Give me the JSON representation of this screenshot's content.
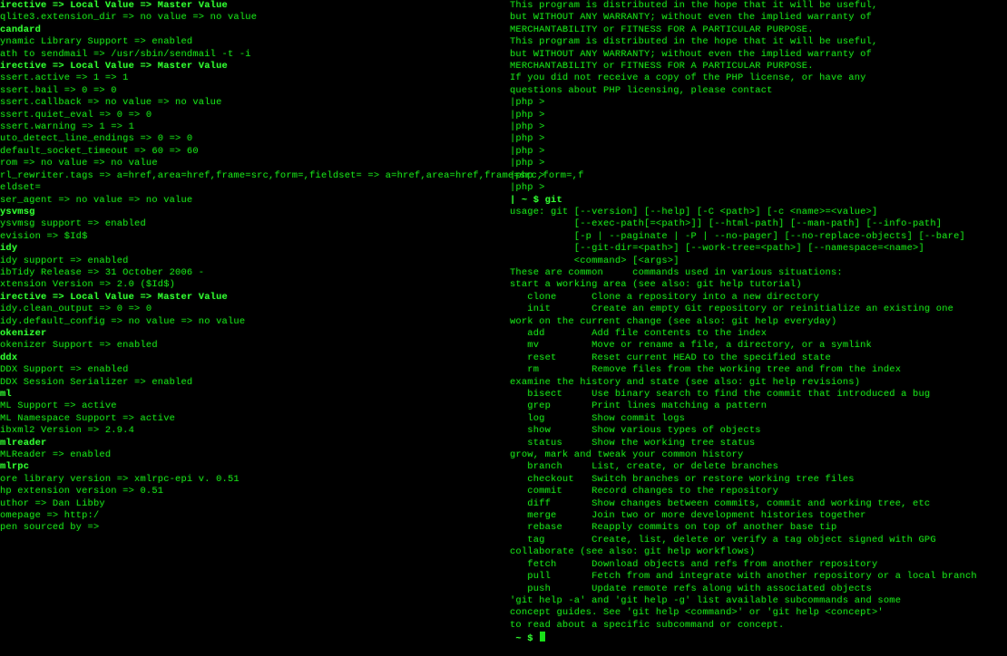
{
  "colors": {
    "background": "#000000",
    "text": "#19e019",
    "bright": "#34ff34"
  },
  "left_column": [
    {
      "t": "irective => Local Value => Master Value",
      "c": "bright"
    },
    {
      "t": "qlite3.extension_dir => no value => no value"
    },
    {
      "t": ""
    },
    {
      "t": "candard",
      "c": "bright"
    },
    {
      "t": ""
    },
    {
      "t": "ynamic Library Support => enabled"
    },
    {
      "t": "ath to sendmail => /usr/sbin/sendmail -t -i"
    },
    {
      "t": ""
    },
    {
      "t": "irective => Local Value => Master Value",
      "c": "bright"
    },
    {
      "t": "ssert.active => 1 => 1"
    },
    {
      "t": "ssert.bail => 0 => 0"
    },
    {
      "t": "ssert.callback => no value => no value"
    },
    {
      "t": "ssert.quiet_eval => 0 => 0"
    },
    {
      "t": "ssert.warning => 1 => 1"
    },
    {
      "t": "uto_detect_line_endings => 0 => 0"
    },
    {
      "t": "default_socket_timeout => 60 => 60"
    },
    {
      "t": "rom => no value => no value"
    },
    {
      "t": "rl_rewriter.tags => a=href,area=href,frame=src,form=,fieldset= => a=href,area=href,frame=src,form=,f"
    },
    {
      "t": "eldset="
    },
    {
      "t": "ser_agent => no value => no value"
    },
    {
      "t": ""
    },
    {
      "t": "ysvmsg",
      "c": "bright"
    },
    {
      "t": ""
    },
    {
      "t": "ysvmsg support => enabled"
    },
    {
      "t": "evision => $Id$"
    },
    {
      "t": ""
    },
    {
      "t": "idy",
      "c": "bright"
    },
    {
      "t": ""
    },
    {
      "t": "idy support => enabled"
    },
    {
      "t": "ibTidy Release => 31 October 2006 -"
    },
    {
      "t": "xtension Version => 2.0 ($Id$)"
    },
    {
      "t": ""
    },
    {
      "t": "irective => Local Value => Master Value",
      "c": "bright"
    },
    {
      "t": "idy.clean_output => 0 => 0"
    },
    {
      "t": "idy.default_config => no value => no value"
    },
    {
      "t": ""
    },
    {
      "t": "okenizer",
      "c": "bright"
    },
    {
      "t": ""
    },
    {
      "t": "okenizer Support => enabled"
    },
    {
      "t": ""
    },
    {
      "t": "ddx",
      "c": "bright"
    },
    {
      "t": ""
    },
    {
      "t": "DDX Support => enabled"
    },
    {
      "t": "DDX Session Serializer => enabled"
    },
    {
      "t": ""
    },
    {
      "t": "ml",
      "c": "bright"
    },
    {
      "t": ""
    },
    {
      "t": "ML Support => active"
    },
    {
      "t": "ML Namespace Support => active"
    },
    {
      "t": "ibxml2 Version => 2.9.4"
    },
    {
      "t": ""
    },
    {
      "t": "mlreader",
      "c": "bright"
    },
    {
      "t": ""
    },
    {
      "t": "MLReader => enabled"
    },
    {
      "t": ""
    },
    {
      "t": "mlrpc",
      "c": "bright"
    },
    {
      "t": ""
    },
    {
      "t": "ore library version => xmlrpc-epi v. 0.51"
    },
    {
      "t": "hp extension version => 0.51"
    },
    {
      "t": "uthor => Dan Libby"
    },
    {
      "t": "omepage => http:/"
    },
    {
      "t": "pen sourced by =>"
    }
  ],
  "right_column": [
    {
      "t": "This program is distributed in the hope that it will be useful,"
    },
    {
      "t": "but WITHOUT ANY WARRANTY; without even the implied warranty of"
    },
    {
      "t": "MERCHANTABILITY or FITNESS FOR A PARTICULAR PURPOSE."
    },
    {
      "t": ""
    },
    {
      "t": "This program is distributed in the hope that it will be useful,"
    },
    {
      "t": "but WITHOUT ANY WARRANTY; without even the implied warranty of"
    },
    {
      "t": "MERCHANTABILITY or FITNESS FOR A PARTICULAR PURPOSE."
    },
    {
      "t": ""
    },
    {
      "t": "If you did not receive a copy of the PHP license, or have any"
    },
    {
      "t": "questions about PHP licensing, please contact"
    },
    {
      "t": "|php >"
    },
    {
      "t": "|php >"
    },
    {
      "t": "|php >"
    },
    {
      "t": "|php >"
    },
    {
      "t": "|php >"
    },
    {
      "t": "|php >"
    },
    {
      "t": "|php >"
    },
    {
      "t": "|php >"
    },
    {
      "t": "| ~ $ git",
      "c": "bright"
    },
    {
      "t": "usage: git [--version] [--help] [-C <path>] [-c <name>=<value>]"
    },
    {
      "t": "           [--exec-path[=<path>]] [--html-path] [--man-path] [--info-path]"
    },
    {
      "t": "           [-p | --paginate | -P | --no-pager] [--no-replace-objects] [--bare]"
    },
    {
      "t": "           [--git-dir=<path>] [--work-tree=<path>] [--namespace=<name>]"
    },
    {
      "t": "           <command> [<args>]"
    },
    {
      "t": ""
    },
    {
      "t": "These are common     commands used in various situations:"
    },
    {
      "t": ""
    },
    {
      "t": "start a working area (see also: git help tutorial)"
    },
    {
      "t": "   clone      Clone a repository into a new directory"
    },
    {
      "t": "   init       Create an empty Git repository or reinitialize an existing one"
    },
    {
      "t": ""
    },
    {
      "t": "work on the current change (see also: git help everyday)"
    },
    {
      "t": "   add        Add file contents to the index"
    },
    {
      "t": "   mv         Move or rename a file, a directory, or a symlink"
    },
    {
      "t": "   reset      Reset current HEAD to the specified state"
    },
    {
      "t": "   rm         Remove files from the working tree and from the index"
    },
    {
      "t": ""
    },
    {
      "t": "examine the history and state (see also: git help revisions)"
    },
    {
      "t": "   bisect     Use binary search to find the commit that introduced a bug"
    },
    {
      "t": "   grep       Print lines matching a pattern"
    },
    {
      "t": "   log        Show commit logs"
    },
    {
      "t": "   show       Show various types of objects"
    },
    {
      "t": "   status     Show the working tree status"
    },
    {
      "t": ""
    },
    {
      "t": "grow, mark and tweak your common history"
    },
    {
      "t": "   branch     List, create, or delete branches"
    },
    {
      "t": "   checkout   Switch branches or restore working tree files"
    },
    {
      "t": "   commit     Record changes to the repository"
    },
    {
      "t": "   diff       Show changes between commits, commit and working tree, etc"
    },
    {
      "t": "   merge      Join two or more development histories together"
    },
    {
      "t": "   rebase     Reapply commits on top of another base tip"
    },
    {
      "t": "   tag        Create, list, delete or verify a tag object signed with GPG"
    },
    {
      "t": ""
    },
    {
      "t": "collaborate (see also: git help workflows)"
    },
    {
      "t": "   fetch      Download objects and refs from another repository"
    },
    {
      "t": "   pull       Fetch from and integrate with another repository or a local branch"
    },
    {
      "t": "   push       Update remote refs along with associated objects"
    },
    {
      "t": ""
    },
    {
      "t": "'git help -a' and 'git help -g' list available subcommands and some"
    },
    {
      "t": "concept guides. See 'git help <command>' or 'git help <concept>'"
    },
    {
      "t": "to read about a specific subcommand or concept."
    },
    {
      "t": " ~ $ ",
      "c": "bright",
      "cursor": true
    }
  ],
  "prompt": {
    "symbol": "~ $",
    "cursor_visible": true
  }
}
